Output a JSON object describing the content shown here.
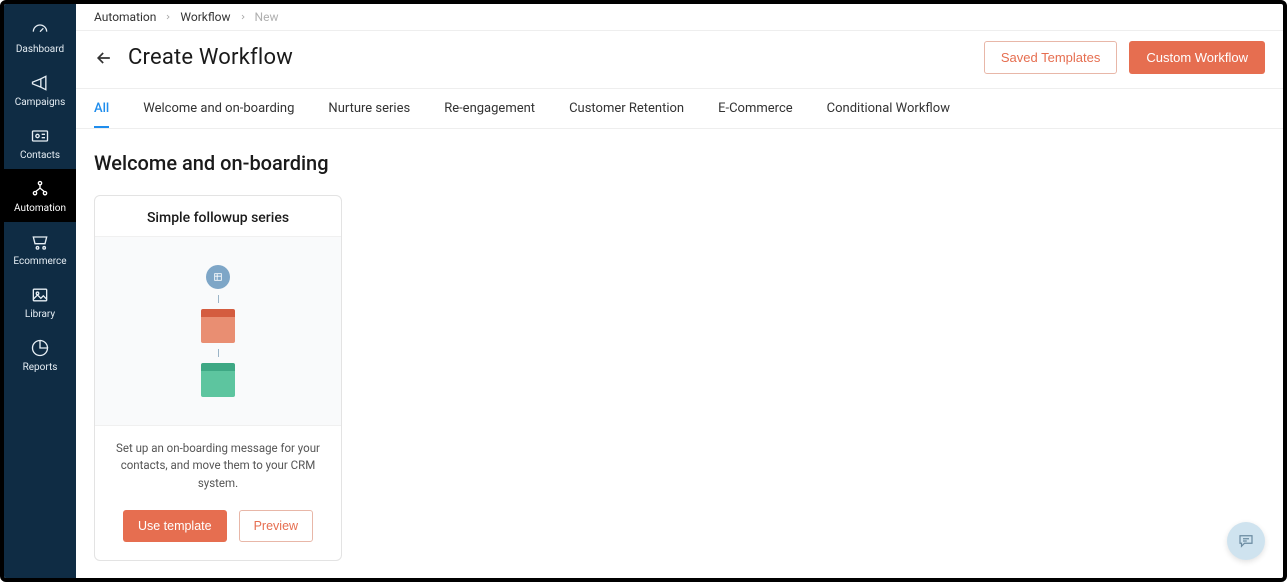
{
  "sidebar": {
    "items": [
      {
        "label": "Dashboard",
        "name": "dashboard"
      },
      {
        "label": "Campaigns",
        "name": "campaigns"
      },
      {
        "label": "Contacts",
        "name": "contacts"
      },
      {
        "label": "Automation",
        "name": "automation"
      },
      {
        "label": "Ecommerce",
        "name": "ecommerce"
      },
      {
        "label": "Library",
        "name": "library"
      },
      {
        "label": "Reports",
        "name": "reports"
      }
    ],
    "active": "automation"
  },
  "breadcrumb": {
    "items": [
      "Automation",
      "Workflow",
      "New"
    ]
  },
  "header": {
    "title": "Create Workflow",
    "saved_templates": "Saved Templates",
    "custom_workflow": "Custom Workflow"
  },
  "tabs": {
    "items": [
      "All",
      "Welcome and on-boarding",
      "Nurture series",
      "Re-engagement",
      "Customer Retention",
      "E-Commerce",
      "Conditional Workflow"
    ],
    "active": "All"
  },
  "section": {
    "title": "Welcome and on-boarding"
  },
  "template_card": {
    "title": "Simple followup series",
    "description": "Set up an on-boarding message for your contacts, and move them to your CRM system.",
    "use_label": "Use template",
    "preview_label": "Preview"
  }
}
